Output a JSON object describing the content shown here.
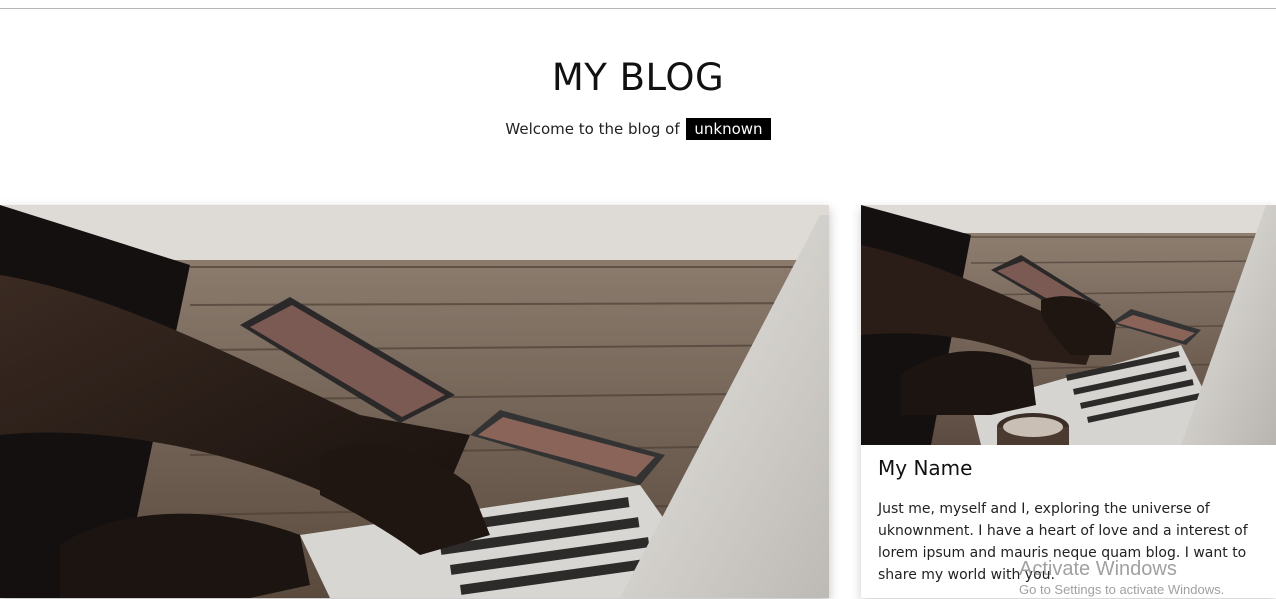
{
  "header": {
    "title": "MY BLOG",
    "welcome_text": "Welcome to the blog of",
    "owner_tag": "unknown"
  },
  "main_card": {
    "image": "laptop-hands-photo"
  },
  "side_card": {
    "image": "laptop-hands-photo",
    "name": "My Name",
    "bio": "Just me, myself and I, exploring the universe of uknownment. I have a heart of love and a interest of lorem ipsum and mauris neque quam blog. I want to share my world with you."
  },
  "watermark": {
    "line1": "Activate Windows",
    "line2": "Go to Settings to activate Windows."
  },
  "colors": {
    "tag_bg": "#000000",
    "tag_text": "#ffffff",
    "page_bg": "#ffffff"
  }
}
